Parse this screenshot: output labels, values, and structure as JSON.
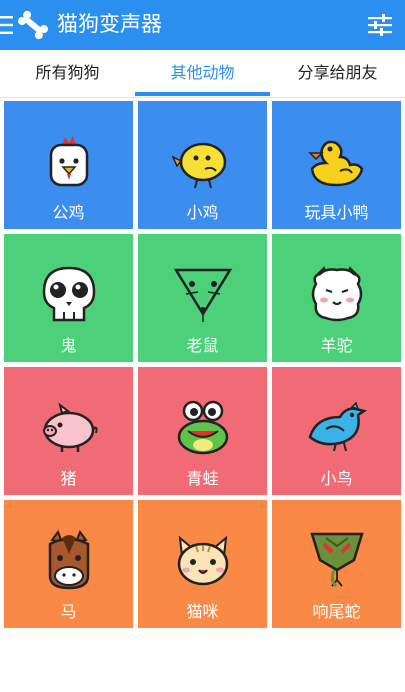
{
  "app": {
    "title": "猫狗变声器"
  },
  "tabs": [
    {
      "label": "所有狗狗"
    },
    {
      "label": "其他动物"
    },
    {
      "label": "分享给朋友"
    }
  ],
  "colors": {
    "blue": "#3b8ef0",
    "green": "#4cd07a",
    "red": "#f06b76",
    "orange": "#f98945"
  },
  "animals": [
    {
      "label": "公鸡",
      "icon": "rooster-icon"
    },
    {
      "label": "小鸡",
      "icon": "chick-icon"
    },
    {
      "label": "玩具小鸭",
      "icon": "rubber-duck-icon"
    },
    {
      "label": "鬼",
      "icon": "skull-icon"
    },
    {
      "label": "老鼠",
      "icon": "mouse-icon"
    },
    {
      "label": "羊驼",
      "icon": "alpaca-icon"
    },
    {
      "label": "猪",
      "icon": "pig-icon"
    },
    {
      "label": "青蛙",
      "icon": "frog-icon"
    },
    {
      "label": "小鸟",
      "icon": "bird-icon"
    },
    {
      "label": "马",
      "icon": "horse-icon"
    },
    {
      "label": "猫咪",
      "icon": "cat-icon"
    },
    {
      "label": "响尾蛇",
      "icon": "rattlesnake-icon"
    }
  ]
}
